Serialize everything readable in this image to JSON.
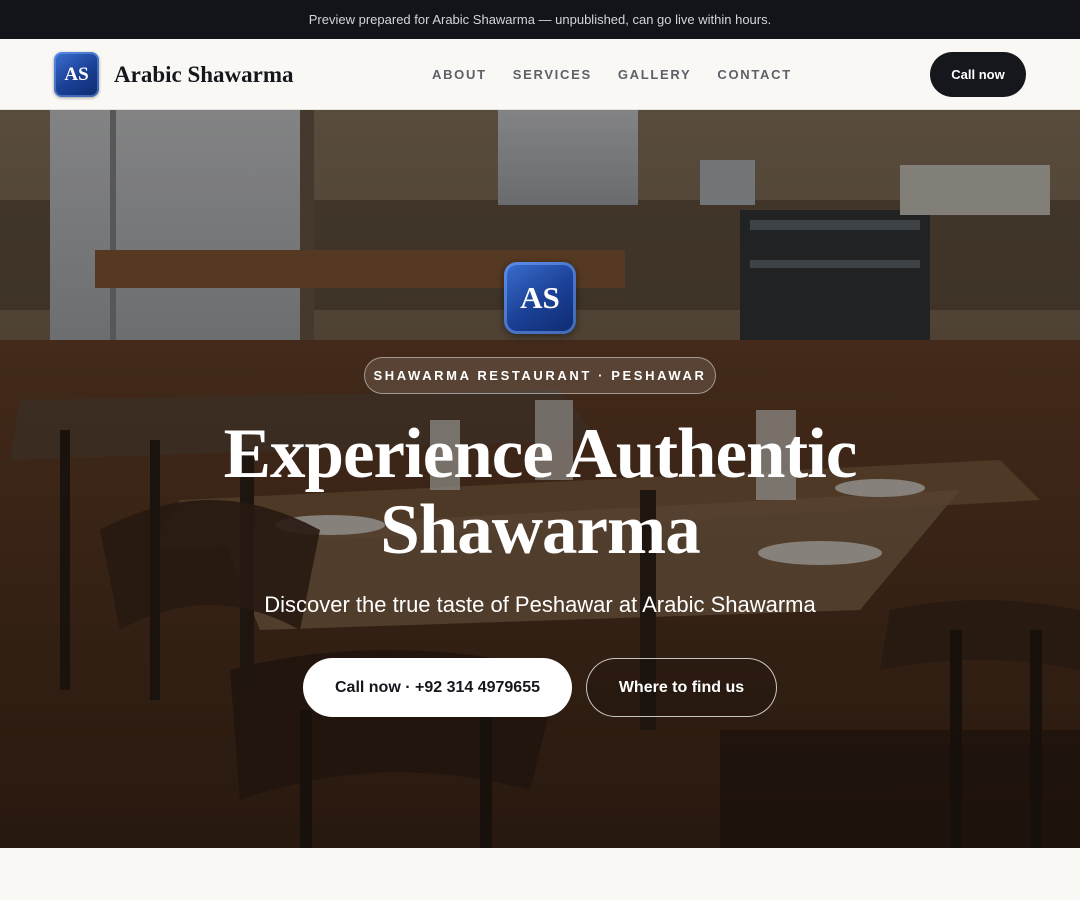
{
  "banner": {
    "text": "Preview prepared for Arabic Shawarma — unpublished, can go live within hours."
  },
  "brand": {
    "logo_text": "AS",
    "name": "Arabic Shawarma"
  },
  "nav": {
    "items": [
      {
        "label": "ABOUT"
      },
      {
        "label": "SERVICES"
      },
      {
        "label": "GALLERY"
      },
      {
        "label": "CONTACT"
      }
    ],
    "cta_label": "Call now"
  },
  "hero": {
    "logo_text": "AS",
    "eyebrow": "SHAWARMA RESTAURANT · PESHAWAR",
    "headline_line1": "Experience Authentic",
    "headline_line2": "Shawarma",
    "subheadline": "Discover the true taste of Peshawar at Arabic Shawarma",
    "primary_button": "Call now · +92 314 4979655",
    "secondary_button": "Where to find us"
  },
  "colors": {
    "banner_bg": "#12141a",
    "page_bg": "#f9f8f5",
    "dark_button": "#15171c",
    "logo_blue": "#1a3f94"
  }
}
